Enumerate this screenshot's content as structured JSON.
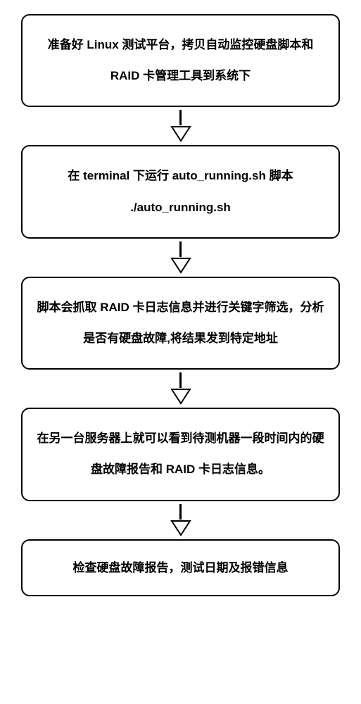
{
  "flowchart": {
    "steps": [
      {
        "text": "准备好 Linux 测试平台，拷贝自动监控硬盘脚本和 RAID 卡管理工具到系统下"
      },
      {
        "text": "在 terminal 下运行 auto_running.sh 脚本 ./auto_running.sh"
      },
      {
        "text": "脚本会抓取 RAID 卡日志信息并进行关键字筛选，分析是否有硬盘故障,将结果发到特定地址"
      },
      {
        "text": "在另一台服务器上就可以看到待测机器一段时间内的硬盘故障报告和 RAID 卡日志信息。"
      },
      {
        "text": "检查硬盘故障报告，测试日期及报错信息"
      }
    ]
  }
}
